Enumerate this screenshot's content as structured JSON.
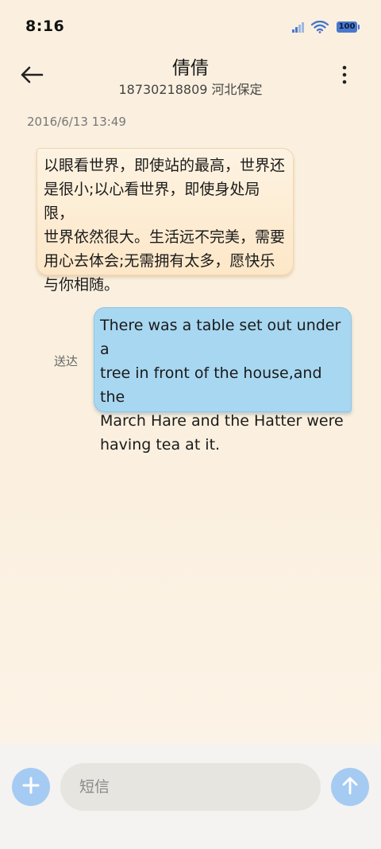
{
  "status_bar": {
    "time": "8:16",
    "battery": "100",
    "icons": [
      "signal-icon",
      "wifi-icon",
      "battery-icon"
    ]
  },
  "header": {
    "back_icon": "arrow-left-icon",
    "contact_name": "倩倩",
    "contact_subtitle": "18730218809 河北保定",
    "more_icon": "more-vertical-icon"
  },
  "conversation": {
    "timestamp": "2016/6/13 13:49",
    "messages": [
      {
        "direction": "incoming",
        "lines": [
          "以眼看世界，即使站的最高，世界还",
          "是很小;以心看世界，即使身处局限，",
          "世界依然很大。生活远不完美，需要",
          "用心去体会;无需拥有太多，愿快乐",
          "与你相随。"
        ]
      },
      {
        "direction": "outgoing",
        "status": "送达",
        "lines": [
          "There was a table set out under a",
          "tree in front of the house,and the",
          "March Hare and the Hatter were",
          "having tea at it."
        ]
      }
    ]
  },
  "compose": {
    "add_icon": "plus-icon",
    "placeholder": "短信",
    "value": "",
    "send_icon": "arrow-up-icon"
  },
  "colors": {
    "background": "#fbf0df",
    "incoming_bubble": "#fde9cc",
    "outgoing_bubble": "#a8d7f1",
    "accent_button": "#a5cbf2",
    "battery": "#4a78cc"
  }
}
